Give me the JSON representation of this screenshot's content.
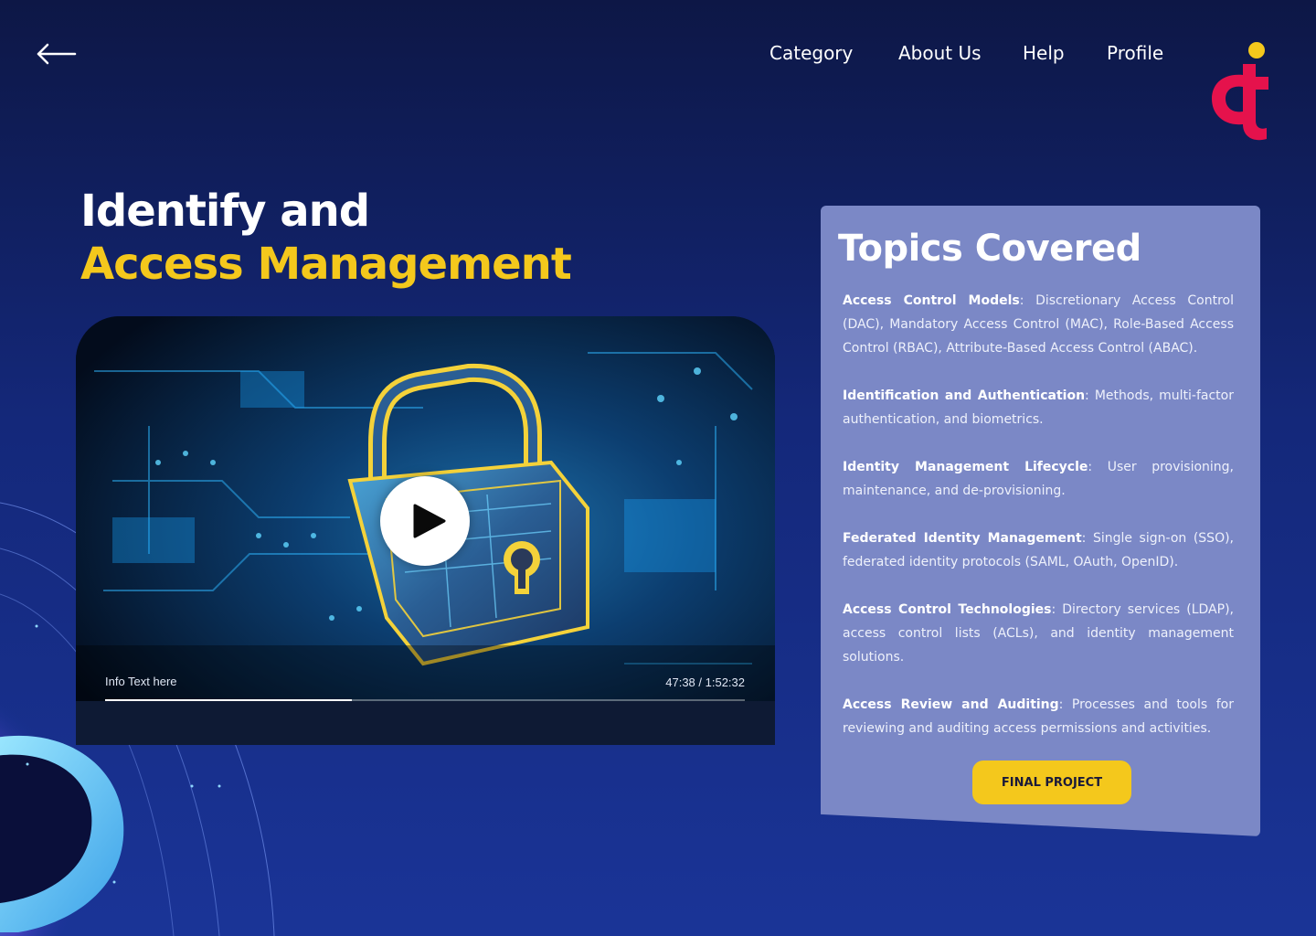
{
  "nav": {
    "items": [
      {
        "label": "Category"
      },
      {
        "label": "About Us"
      },
      {
        "label": "Help"
      },
      {
        "label": "Profile"
      }
    ]
  },
  "hero": {
    "title_line1": "Identify and",
    "title_line2": "Access Management"
  },
  "video": {
    "info_text": "Info Text here",
    "time": "47:38 / 1:52:32",
    "progress": 0.385
  },
  "topics": {
    "title": "Topics Covered",
    "items": [
      {
        "heading": "Access Control Models",
        "body": ": Discretionary Access Control (DAC), Mandatory Access Control (MAC), Role-Based Access Control (RBAC), Attribute-Based Access Control (ABAC)."
      },
      {
        "heading": "Identification and Authentication",
        "body": ": Methods, multi-factor authentication, and biometrics."
      },
      {
        "heading": "Identity Management Lifecycle",
        "body": ": User provisioning, maintenance, and de-provisioning."
      },
      {
        "heading": "Federated Identity Management",
        "body": ": Single sign-on (SSO), federated identity protocols (SAML, OAuth, OpenID)."
      },
      {
        "heading": "Access Control Technologies",
        "body": ": Directory services (LDAP), access control lists (ACLs), and identity management solutions."
      },
      {
        "heading": "Access Review and Auditing",
        "body": ": Processes and tools for reviewing and auditing access permissions and activities."
      }
    ],
    "button_label": "FINAL PROJECT"
  },
  "colors": {
    "accent": "#f4c81c",
    "logo_red": "#e5124c",
    "panel": "#7b88c6"
  },
  "icons": [
    "back-arrow-icon",
    "play-icon",
    "brand-logo"
  ]
}
